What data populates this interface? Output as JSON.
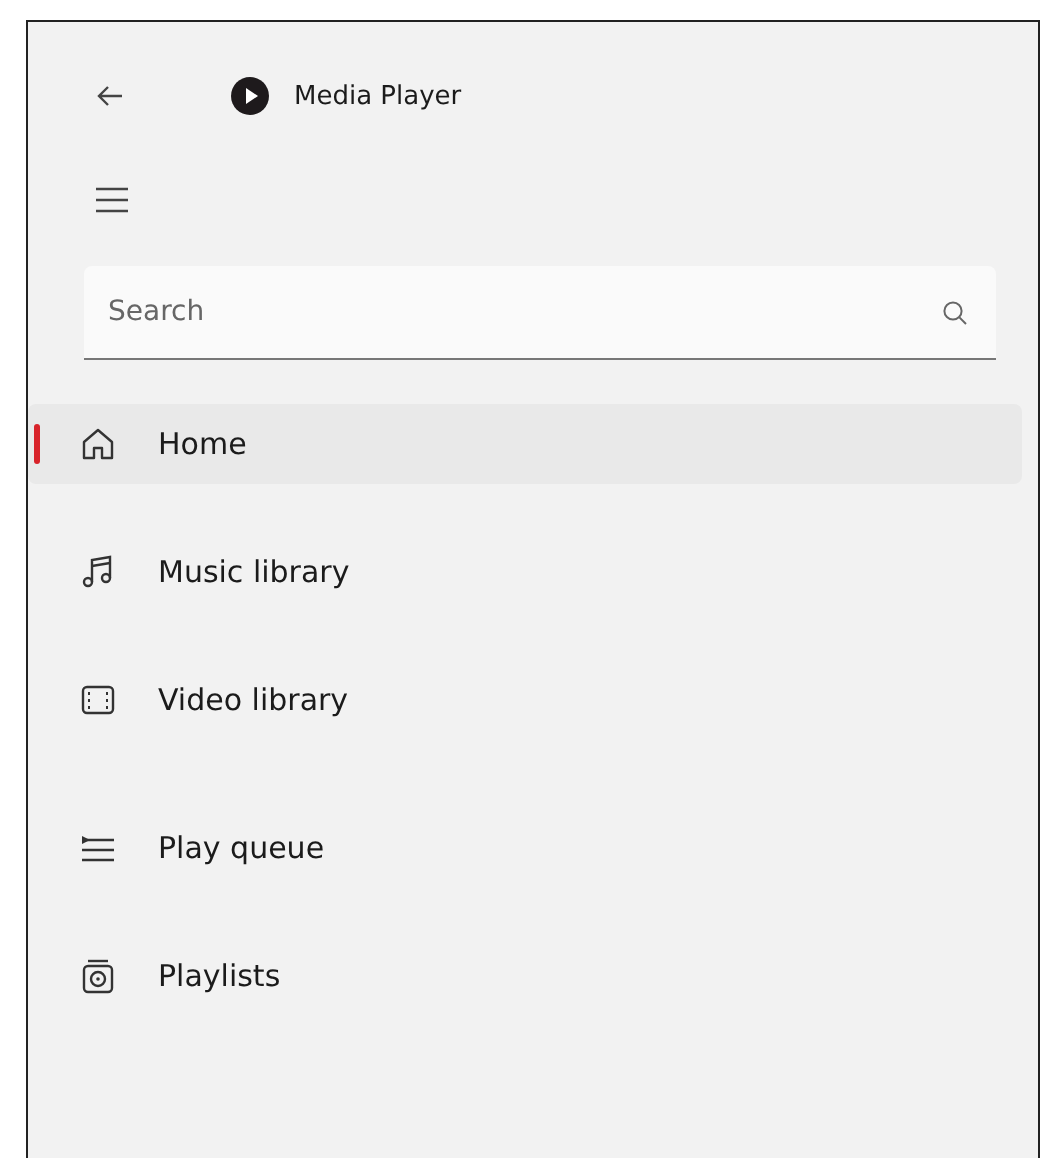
{
  "window": {
    "title": "Media Player"
  },
  "search": {
    "placeholder": "Search"
  },
  "nav_groups": [
    [
      {
        "label": "Home",
        "selected": true
      },
      {
        "label": "Music library",
        "selected": false
      },
      {
        "label": "Video library",
        "selected": false
      }
    ],
    [
      {
        "label": "Play queue",
        "selected": false
      },
      {
        "label": "Playlists",
        "selected": false
      }
    ]
  ]
}
